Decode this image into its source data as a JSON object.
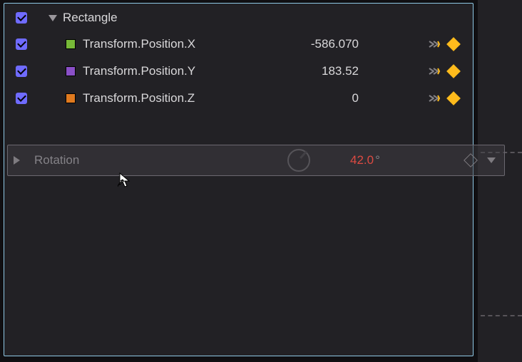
{
  "colors": {
    "checkbox": "#6f6bff",
    "diamond": "#ffbb1c",
    "drag_value": "#dd4a42",
    "swatches": {
      "x": "#77b938",
      "y": "#8a50c7",
      "z": "#e07a1f"
    }
  },
  "rows": {
    "header": {
      "label": "Rectangle"
    },
    "x": {
      "swatch": "x",
      "label": "Transform.Position.X",
      "value": "-586.070"
    },
    "y": {
      "swatch": "y",
      "label": "Transform.Position.Y",
      "value": "183.52"
    },
    "z": {
      "swatch": "z",
      "label": "Transform.Position.Z",
      "value": "0"
    }
  },
  "drag": {
    "label": "Rotation",
    "value": "42.0",
    "unit": "°"
  }
}
